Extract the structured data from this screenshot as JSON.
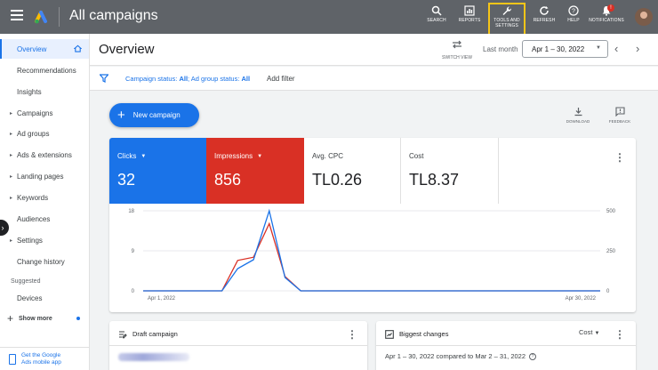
{
  "app": {
    "title": "All campaigns"
  },
  "top_actions": [
    {
      "id": "search",
      "label": "SEARCH"
    },
    {
      "id": "reports",
      "label": "REPORTS"
    },
    {
      "id": "tools",
      "label": "TOOLS AND SETTINGS"
    },
    {
      "id": "refresh",
      "label": "REFRESH"
    },
    {
      "id": "help",
      "label": "HELP"
    },
    {
      "id": "notifications",
      "label": "NOTIFICATIONS"
    }
  ],
  "notifications_badge": "!",
  "sidebar": {
    "items": [
      {
        "label": "Overview",
        "active": true,
        "caret": false
      },
      {
        "label": "Recommendations",
        "caret": false
      },
      {
        "label": "Insights",
        "caret": false
      },
      {
        "label": "Campaigns",
        "caret": true
      },
      {
        "label": "Ad groups",
        "caret": true
      },
      {
        "label": "Ads & extensions",
        "caret": true
      },
      {
        "label": "Landing pages",
        "caret": true
      },
      {
        "label": "Keywords",
        "caret": true
      },
      {
        "label": "Audiences",
        "caret": false
      },
      {
        "label": "Settings",
        "caret": true
      },
      {
        "label": "Change history",
        "caret": false
      }
    ],
    "suggested_label": "Suggested",
    "suggested_items": [
      {
        "label": "Devices"
      }
    ],
    "show_more": "Show more",
    "mobile_app_line1": "Get the Google",
    "mobile_app_line2": "Ads mobile app"
  },
  "header": {
    "title": "Overview",
    "switch_view": "SWITCH VIEW",
    "range_label": "Last month",
    "date_range": "Apr 1 – 30, 2022"
  },
  "filter": {
    "status_prefix": "Campaign status: ",
    "campaign_status": "All",
    "adgroup_prefix": "; Ad group status: ",
    "adgroup_status": "All",
    "add_filter": "Add filter"
  },
  "new_campaign": "New campaign",
  "actions": {
    "download": "DOWNLOAD",
    "feedback": "FEEDBACK"
  },
  "metrics": {
    "clicks": {
      "label": "Clicks",
      "value": "32"
    },
    "impressions": {
      "label": "Impressions",
      "value": "856"
    },
    "avg_cpc": {
      "label": "Avg. CPC",
      "value": "TL0.26"
    },
    "cost": {
      "label": "Cost",
      "value": "TL8.37"
    }
  },
  "colors": {
    "clicks": "#1a73e8",
    "impressions": "#d93025"
  },
  "chart_data": {
    "type": "line",
    "x_start_label": "Apr 1, 2022",
    "x_end_label": "Apr 30, 2022",
    "y_left_ticks": [
      "18",
      "9",
      "0"
    ],
    "y_right_ticks": [
      "500",
      "250",
      "0"
    ],
    "y_left_range": [
      0,
      18
    ],
    "y_right_range": [
      0,
      500
    ],
    "x": [
      1,
      2,
      3,
      4,
      5,
      6,
      7,
      8,
      9,
      10,
      11,
      12,
      13,
      14,
      15,
      16,
      17,
      18,
      19,
      20,
      21,
      22,
      23,
      24,
      25,
      26,
      27,
      28,
      29,
      30
    ],
    "series": [
      {
        "name": "Clicks",
        "axis": "left",
        "values": [
          0,
          0,
          0,
          0,
          0,
          0,
          5,
          7,
          18,
          3,
          0,
          0,
          0,
          0,
          0,
          0,
          0,
          0,
          0,
          0,
          0,
          0,
          0,
          0,
          0,
          0,
          0,
          0,
          0,
          0
        ]
      },
      {
        "name": "Impressions",
        "axis": "right",
        "values": [
          0,
          0,
          0,
          0,
          0,
          0,
          190,
          210,
          420,
          90,
          0,
          0,
          0,
          0,
          0,
          0,
          0,
          0,
          0,
          0,
          0,
          0,
          0,
          0,
          0,
          0,
          0,
          0,
          0,
          0
        ]
      }
    ],
    "grid": true
  },
  "bottom_cards": {
    "draft": {
      "title": "Draft campaign"
    },
    "changes": {
      "title": "Biggest changes",
      "metric": "Cost",
      "compare": "Apr 1 – 30, 2022 compared to Mar 2 – 31, 2022"
    }
  }
}
